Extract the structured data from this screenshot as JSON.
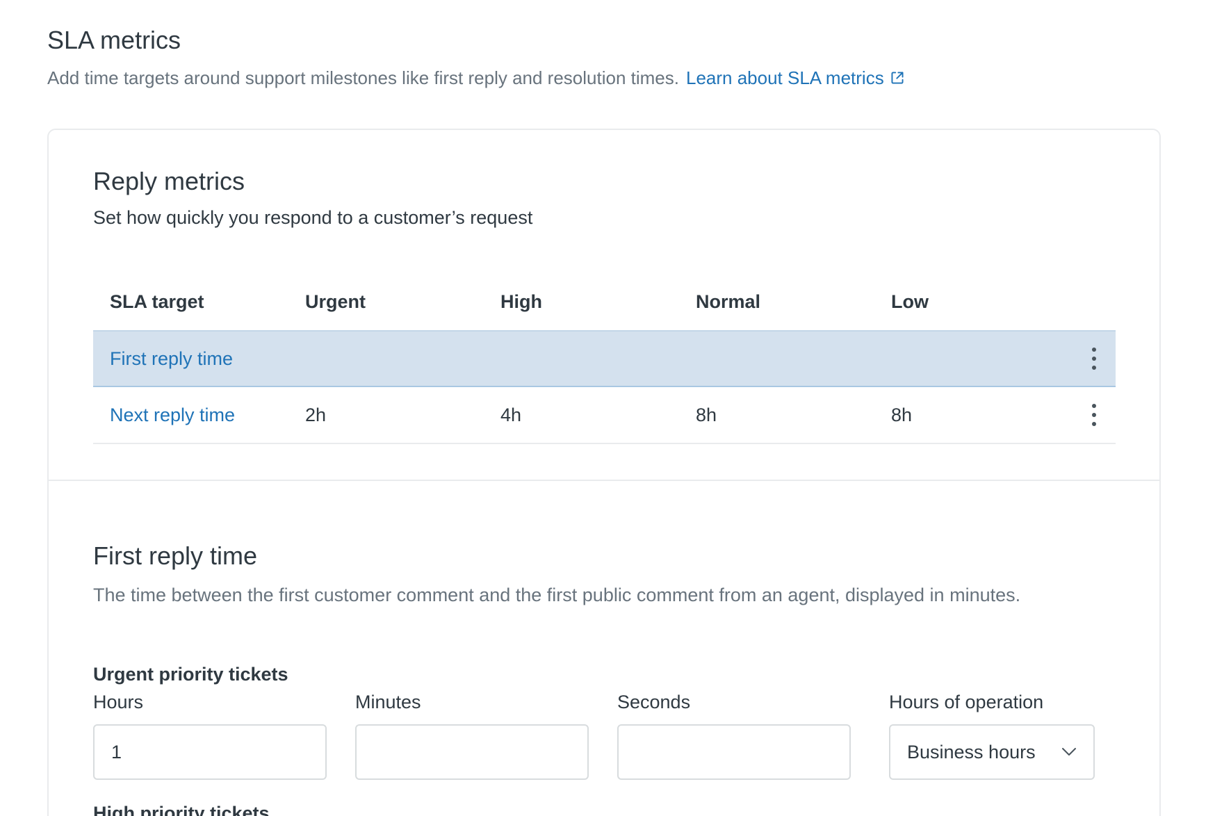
{
  "header": {
    "title": "SLA metrics",
    "description": "Add time targets around support milestones like first reply and resolution times.",
    "learn_link": "Learn about SLA metrics"
  },
  "reply_metrics": {
    "title": "Reply metrics",
    "subtitle": "Set how quickly you respond to a customer’s request",
    "columns": [
      "SLA target",
      "Urgent",
      "High",
      "Normal",
      "Low"
    ],
    "rows": [
      {
        "name": "First reply time",
        "urgent": "",
        "high": "",
        "normal": "",
        "low": "",
        "selected": true
      },
      {
        "name": "Next reply time",
        "urgent": "2h",
        "high": "4h",
        "normal": "8h",
        "low": "8h",
        "selected": false
      }
    ]
  },
  "detail": {
    "title": "First reply time",
    "description": "The time between the first customer comment and the first public comment from an agent, displayed in minutes.",
    "urgent_label": "Urgent priority tickets",
    "fields": {
      "hours_label": "Hours",
      "hours_value": "1",
      "minutes_label": "Minutes",
      "minutes_value": "",
      "seconds_label": "Seconds",
      "seconds_value": "",
      "operation_label": "Hours of operation",
      "operation_value": "Business hours"
    },
    "next_label": "High priority tickets"
  },
  "colors": {
    "link": "#1f73b7",
    "selected_row": "#d4e1ee",
    "muted_text": "#68737d",
    "border": "#e9ebed"
  }
}
